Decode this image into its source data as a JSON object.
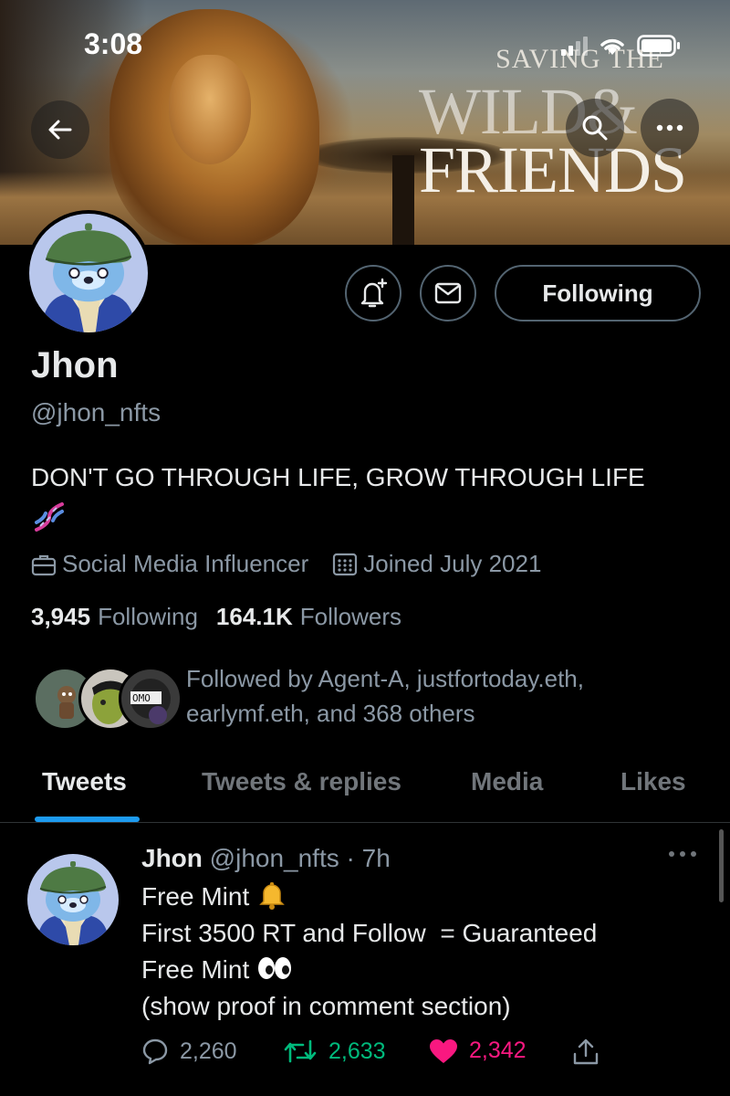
{
  "status_bar": {
    "time": "3:08"
  },
  "banner": {
    "line1": "SAVING THE",
    "line2": "WILD&",
    "line3": "FRIENDS"
  },
  "profile": {
    "name": "Jhon",
    "handle": "@jhon_nfts",
    "bio": "DON'T GO THROUGH LIFE, GROW THROUGH LIFE",
    "bio_emoji": "dna-emoji",
    "category": "Social Media Influencer",
    "joined": "Joined July 2021",
    "following_count": "3,945",
    "following_label": "Following",
    "followers_count": "164.1K",
    "followers_label": "Followers",
    "followed_by_line1": "Followed by Agent-A, justfortoday.eth,",
    "followed_by_line2": "earlymf.eth, and 368 others",
    "follow_button_label": "Following"
  },
  "tabs": [
    {
      "label": "Tweets",
      "active": true
    },
    {
      "label": "Tweets & replies",
      "active": false
    },
    {
      "label": "Media",
      "active": false
    },
    {
      "label": "Likes",
      "active": false
    }
  ],
  "tweet": {
    "author": "Jhon",
    "handle_time": "@jhon_nfts · 7h",
    "lines": [
      "Free Mint",
      "First 3500 RT and Follow  = Guaranteed",
      "Free Mint",
      "(show proof in comment section)"
    ],
    "replies": "2,260",
    "retweets": "2,633",
    "likes": "2,342"
  },
  "colors": {
    "accent": "#1d9bf0",
    "retweet": "#00ba7c",
    "like": "#f91880",
    "muted": "#8b98a5"
  }
}
